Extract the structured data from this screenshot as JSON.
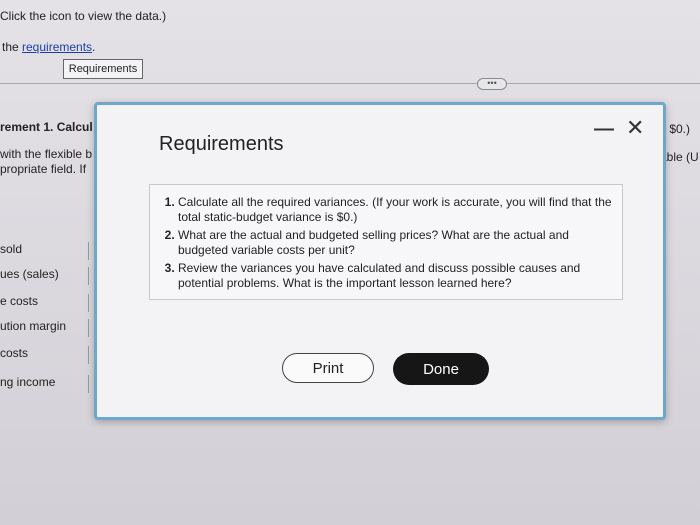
{
  "background": {
    "instruction": "Click the icon to view the data.)",
    "req_prefix": "the ",
    "req_link": "requirements",
    "req_suffix": ".",
    "req_button": "Requirements",
    "ellipsis": "•••",
    "req_heading": "rement 1. Calcul",
    "flexible_line": "with the flexible b",
    "field_line": "propriate field. If",
    "right_top": "s $0.)",
    "right_bottom": "able (U",
    "rows": [
      "sold",
      "ues (sales)",
      "e costs",
      "ution margin",
      "costs",
      "ng income"
    ]
  },
  "modal": {
    "title": "Requirements",
    "minimize_symbol": "—",
    "close_symbol": "✕",
    "requirements": [
      "Calculate all the required variances. (If your work is accurate, you will find that the total static-budget variance is $0.)",
      "What are the actual and budgeted selling prices? What are the actual and budgeted variable costs per unit?",
      "Review the variances you have calculated and discuss possible causes and potential problems. What is the important lesson learned here?"
    ],
    "print_label": "Print",
    "done_label": "Done"
  }
}
